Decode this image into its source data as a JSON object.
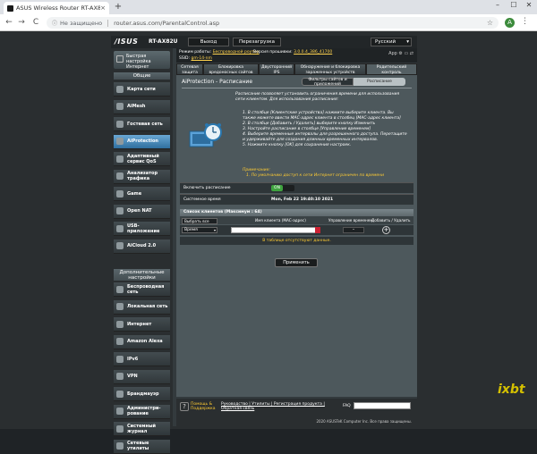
{
  "browser": {
    "tab_title": "ASUS Wireless Router RT-AX82U",
    "tab_close": "×",
    "new_tab": "+",
    "minimize": "–",
    "maximize": "☐",
    "close": "✕",
    "back": "←",
    "forward": "→",
    "reload": "C",
    "lock_icon": "ⓘ",
    "not_secure": "Не защищено",
    "url": "router.asus.com/ParentalControl.asp",
    "star": "☆",
    "avatar_letter": "A",
    "menu": "⋮"
  },
  "header": {
    "logo": "/ISUS",
    "model": "RT-AX82U",
    "logout": "Выход",
    "reboot": "Перезагрузка",
    "language": "Русский"
  },
  "status": {
    "mode_label": "Режим работы:",
    "mode_value": "Беспроводной роутер",
    "fw_label": "Версия прошивки:",
    "fw_value": "3.0.0.4_386_41700",
    "ssid_label": "SSID:",
    "ssid_value": "gm-14-nm",
    "icons": "App ⚙ ▭ ⇄"
  },
  "sidebar": {
    "quick_setup": "Быстрая настройка Интернет",
    "general": "Общие",
    "items": [
      {
        "label": "Карта сети",
        "icon": "network-map-icon"
      },
      {
        "label": "AiMesh",
        "icon": "aimesh-icon"
      },
      {
        "label": "Гостевая сеть",
        "icon": "guest-network-icon"
      },
      {
        "label": "AiProtection",
        "icon": "aiprotection-icon"
      },
      {
        "label": "Адаптивный сервис QoS",
        "icon": "qos-icon"
      },
      {
        "label": "Анализатор трафика",
        "icon": "traffic-analyzer-icon"
      },
      {
        "label": "Game",
        "icon": "game-icon"
      },
      {
        "label": "Open NAT",
        "icon": "open-nat-icon"
      },
      {
        "label": "USB-приложение",
        "icon": "usb-icon"
      },
      {
        "label": "AiCloud 2.0",
        "icon": "aicloud-icon"
      }
    ],
    "advanced": "Дополнительные настройки",
    "adv_items": [
      {
        "label": "Беспроводная сеть",
        "icon": "wireless-icon"
      },
      {
        "label": "Локальная сеть",
        "icon": "lan-icon"
      },
      {
        "label": "Интернет",
        "icon": "wan-icon"
      },
      {
        "label": "Amazon Alexa",
        "icon": "alexa-icon"
      },
      {
        "label": "IPv6",
        "icon": "ipv6-icon"
      },
      {
        "label": "VPN",
        "icon": "vpn-icon"
      },
      {
        "label": "Брандмауэр",
        "icon": "firewall-icon"
      },
      {
        "label": "Администри-рование",
        "icon": "admin-icon"
      },
      {
        "label": "Системный журнал",
        "icon": "syslog-icon"
      },
      {
        "label": "Сетевые утилиты",
        "icon": "tools-icon"
      }
    ]
  },
  "subtabs": [
    "Сетевая защита",
    "Блокировка вредоносных сайтов",
    "Двусторонний IPS",
    "Обнаружение и блокировка зараженных устройств",
    "Родительский контроль"
  ],
  "content": {
    "title": "AiProtection - Расписание",
    "tab_filters": "Фильтры сайтов и приложений",
    "tab_schedule": "Расписание",
    "description": "Расписание позволяет установить ограничения времени для использования сети клиентом. Для использования расписания:",
    "steps": [
      "1. В столбце [Клиентские устройства] нажмите выберите клиента. Вы также можете ввести MAC-адрес клиента в столбец [MAC-адрес клиента]",
      "2. В столбце [Добавить / Удалить] выберите кнопку Изменить",
      "3. Настройте расписание в столбце [Управление временем]",
      "4. Выберите временные интервалы для разрешенного доступа. Перетащите и удерживайте для создания длинных временных интервалов.",
      "5. Нажмите кнопку [OK] для сохранения настроек."
    ],
    "note_title": "Примечание:",
    "note_text": "1. По умолчанию доступ к сети Интернет ограничен по времени",
    "enable_label": "Включить расписание",
    "toggle_on": "ON",
    "systime_label": "Системное время",
    "systime_value": "Mon, Feb 22 19:40:10 2021",
    "table_title": "Список клиентов (Максимум : 64)",
    "select_all": "Выбрать все",
    "col_name": "Имя клиента (MAC-адрес)",
    "col_time": "Управление временем",
    "col_add": "Добавить / Удалить",
    "row_select": "Время",
    "row_dash": "–",
    "row_plus": "+",
    "empty": "В таблице отсутствуют данные.",
    "apply": "Применить"
  },
  "footer": {
    "help_icon": "?",
    "help": "Помощь & Поддержка",
    "links": "Руководство | Утилиты | Регистрация продукта | Обратная связь",
    "faq": "FAQ",
    "copyright": "2020 ASUSTeK Computer Inc. Все права защищены."
  },
  "watermark": "ixbt"
}
